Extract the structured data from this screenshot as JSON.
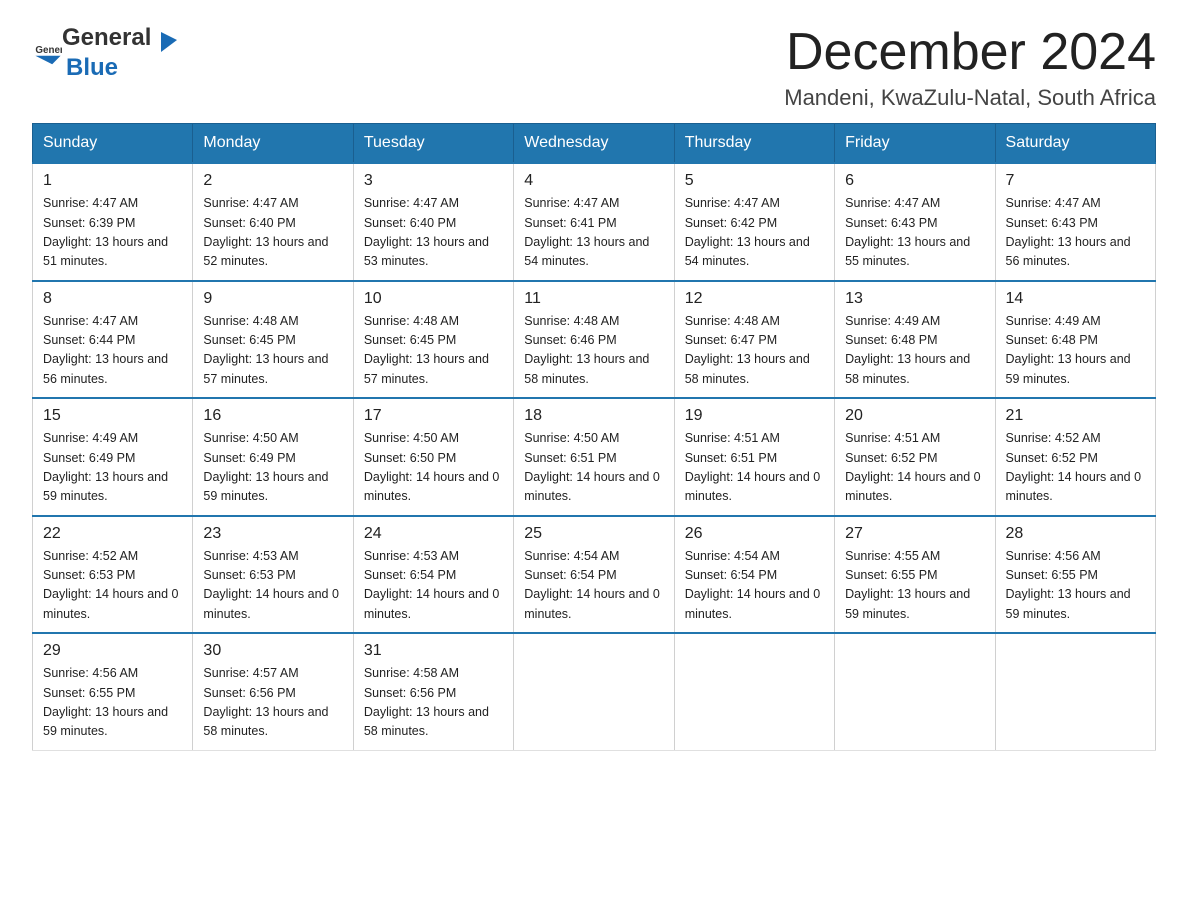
{
  "header": {
    "logo_general": "General",
    "logo_blue": "Blue",
    "month_title": "December 2024",
    "location": "Mandeni, KwaZulu-Natal, South Africa"
  },
  "days_of_week": [
    "Sunday",
    "Monday",
    "Tuesday",
    "Wednesday",
    "Thursday",
    "Friday",
    "Saturday"
  ],
  "weeks": [
    [
      {
        "day": "1",
        "sunrise": "4:47 AM",
        "sunset": "6:39 PM",
        "daylight": "13 hours and 51 minutes."
      },
      {
        "day": "2",
        "sunrise": "4:47 AM",
        "sunset": "6:40 PM",
        "daylight": "13 hours and 52 minutes."
      },
      {
        "day": "3",
        "sunrise": "4:47 AM",
        "sunset": "6:40 PM",
        "daylight": "13 hours and 53 minutes."
      },
      {
        "day": "4",
        "sunrise": "4:47 AM",
        "sunset": "6:41 PM",
        "daylight": "13 hours and 54 minutes."
      },
      {
        "day": "5",
        "sunrise": "4:47 AM",
        "sunset": "6:42 PM",
        "daylight": "13 hours and 54 minutes."
      },
      {
        "day": "6",
        "sunrise": "4:47 AM",
        "sunset": "6:43 PM",
        "daylight": "13 hours and 55 minutes."
      },
      {
        "day": "7",
        "sunrise": "4:47 AM",
        "sunset": "6:43 PM",
        "daylight": "13 hours and 56 minutes."
      }
    ],
    [
      {
        "day": "8",
        "sunrise": "4:47 AM",
        "sunset": "6:44 PM",
        "daylight": "13 hours and 56 minutes."
      },
      {
        "day": "9",
        "sunrise": "4:48 AM",
        "sunset": "6:45 PM",
        "daylight": "13 hours and 57 minutes."
      },
      {
        "day": "10",
        "sunrise": "4:48 AM",
        "sunset": "6:45 PM",
        "daylight": "13 hours and 57 minutes."
      },
      {
        "day": "11",
        "sunrise": "4:48 AM",
        "sunset": "6:46 PM",
        "daylight": "13 hours and 58 minutes."
      },
      {
        "day": "12",
        "sunrise": "4:48 AM",
        "sunset": "6:47 PM",
        "daylight": "13 hours and 58 minutes."
      },
      {
        "day": "13",
        "sunrise": "4:49 AM",
        "sunset": "6:48 PM",
        "daylight": "13 hours and 58 minutes."
      },
      {
        "day": "14",
        "sunrise": "4:49 AM",
        "sunset": "6:48 PM",
        "daylight": "13 hours and 59 minutes."
      }
    ],
    [
      {
        "day": "15",
        "sunrise": "4:49 AM",
        "sunset": "6:49 PM",
        "daylight": "13 hours and 59 minutes."
      },
      {
        "day": "16",
        "sunrise": "4:50 AM",
        "sunset": "6:49 PM",
        "daylight": "13 hours and 59 minutes."
      },
      {
        "day": "17",
        "sunrise": "4:50 AM",
        "sunset": "6:50 PM",
        "daylight": "14 hours and 0 minutes."
      },
      {
        "day": "18",
        "sunrise": "4:50 AM",
        "sunset": "6:51 PM",
        "daylight": "14 hours and 0 minutes."
      },
      {
        "day": "19",
        "sunrise": "4:51 AM",
        "sunset": "6:51 PM",
        "daylight": "14 hours and 0 minutes."
      },
      {
        "day": "20",
        "sunrise": "4:51 AM",
        "sunset": "6:52 PM",
        "daylight": "14 hours and 0 minutes."
      },
      {
        "day": "21",
        "sunrise": "4:52 AM",
        "sunset": "6:52 PM",
        "daylight": "14 hours and 0 minutes."
      }
    ],
    [
      {
        "day": "22",
        "sunrise": "4:52 AM",
        "sunset": "6:53 PM",
        "daylight": "14 hours and 0 minutes."
      },
      {
        "day": "23",
        "sunrise": "4:53 AM",
        "sunset": "6:53 PM",
        "daylight": "14 hours and 0 minutes."
      },
      {
        "day": "24",
        "sunrise": "4:53 AM",
        "sunset": "6:54 PM",
        "daylight": "14 hours and 0 minutes."
      },
      {
        "day": "25",
        "sunrise": "4:54 AM",
        "sunset": "6:54 PM",
        "daylight": "14 hours and 0 minutes."
      },
      {
        "day": "26",
        "sunrise": "4:54 AM",
        "sunset": "6:54 PM",
        "daylight": "14 hours and 0 minutes."
      },
      {
        "day": "27",
        "sunrise": "4:55 AM",
        "sunset": "6:55 PM",
        "daylight": "13 hours and 59 minutes."
      },
      {
        "day": "28",
        "sunrise": "4:56 AM",
        "sunset": "6:55 PM",
        "daylight": "13 hours and 59 minutes."
      }
    ],
    [
      {
        "day": "29",
        "sunrise": "4:56 AM",
        "sunset": "6:55 PM",
        "daylight": "13 hours and 59 minutes."
      },
      {
        "day": "30",
        "sunrise": "4:57 AM",
        "sunset": "6:56 PM",
        "daylight": "13 hours and 58 minutes."
      },
      {
        "day": "31",
        "sunrise": "4:58 AM",
        "sunset": "6:56 PM",
        "daylight": "13 hours and 58 minutes."
      },
      null,
      null,
      null,
      null
    ]
  ]
}
